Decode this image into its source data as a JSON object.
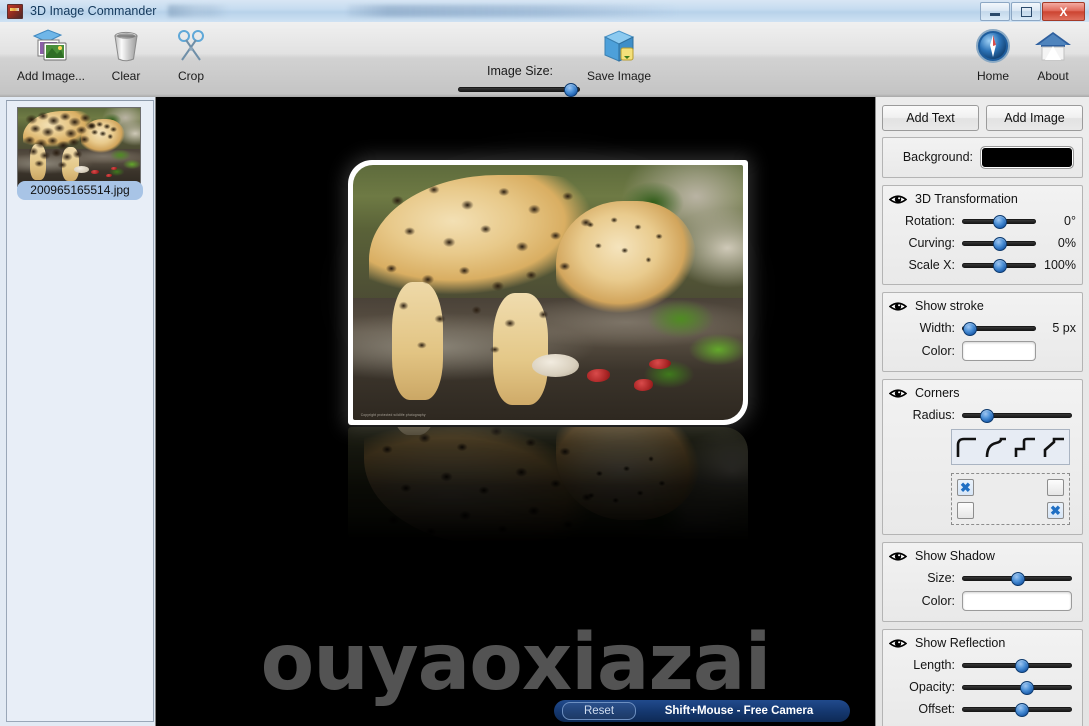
{
  "window": {
    "title": "3D Image Commander",
    "minimize_label": "Minimize",
    "maximize_label": "Maximize",
    "close_label": "X"
  },
  "toolbar": {
    "add_image_label": "Add Image...",
    "clear_label": "Clear",
    "crop_label": "Crop",
    "image_size_label": "Image Size:",
    "image_size_percent": 92,
    "save_image_label": "Save Image",
    "home_label": "Home",
    "about_label": "About"
  },
  "left_panel": {
    "items": [
      {
        "filename": "200965165514.jpg",
        "selected": true
      }
    ]
  },
  "canvas": {
    "watermark": "ouyaoxiazai",
    "photo_caption": "Copyright protected wildlife photography",
    "status": {
      "reset_label": "Reset",
      "hint": "Shift+Mouse - Free Camera"
    }
  },
  "right_panel": {
    "add_text_label": "Add Text",
    "add_image_label": "Add Image",
    "background": {
      "label": "Background:",
      "color": "#000000"
    },
    "transform": {
      "title": "3D Transformation",
      "rotation_label": "Rotation:",
      "rotation_value": "0°",
      "rotation_percent": 50,
      "curving_label": "Curving:",
      "curving_value": "0%",
      "curving_percent": 50,
      "scale_x_label": "Scale X:",
      "scale_x_value": "100%",
      "scale_x_percent": 50
    },
    "stroke": {
      "title": "Show stroke",
      "width_label": "Width:",
      "width_value": "5 px",
      "width_percent": 10,
      "color_label": "Color:",
      "color": "#ffffff"
    },
    "corners": {
      "title": "Corners",
      "radius_label": "Radius:",
      "radius_percent": 22,
      "styles": [
        "corner-round",
        "corner-curve-in",
        "corner-step",
        "corner-bevel"
      ],
      "selected_style_index": 0,
      "checks": {
        "top_left": true,
        "top_right": false,
        "bottom_left": false,
        "bottom_right": true
      },
      "check_glyph": "✖"
    },
    "shadow": {
      "title": "Show Shadow",
      "size_label": "Size:",
      "size_percent": 50,
      "color_label": "Color:",
      "color": "#ffffff"
    },
    "reflection": {
      "title": "Show Reflection",
      "length_label": "Length:",
      "length_percent": 54,
      "opacity_label": "Opacity:",
      "opacity_percent": 58,
      "offset_label": "Offset:",
      "offset_percent": 54
    }
  }
}
